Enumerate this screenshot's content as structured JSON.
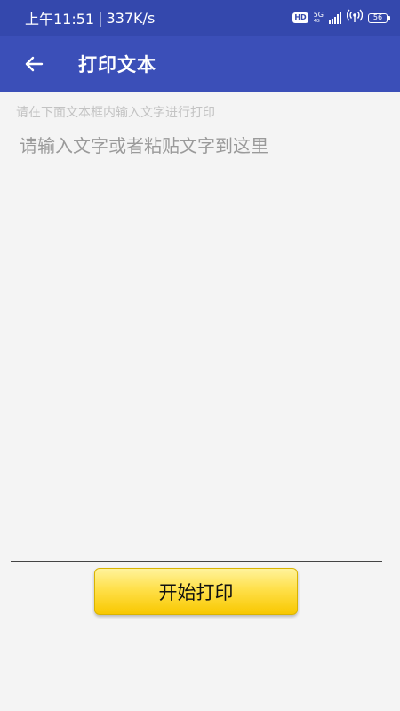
{
  "status_bar": {
    "time": "上午11:51",
    "separator": "|",
    "net_speed": "337K/s",
    "hd_label": "HD",
    "network_type": "5G",
    "network_sub": "4G",
    "battery_level": "56"
  },
  "app_bar": {
    "title": "打印文本",
    "back_icon": "arrow-left-icon"
  },
  "main": {
    "hint": "请在下面文本框内输入文字进行打印",
    "input_placeholder": "请输入文字或者粘贴文字到这里",
    "input_value": ""
  },
  "actions": {
    "print_label": "开始打印"
  },
  "colors": {
    "status_bar": "#3448ad",
    "app_bar": "#3b4fb8",
    "button_yellow": "#ffe04a",
    "background": "#f4f4f4"
  }
}
